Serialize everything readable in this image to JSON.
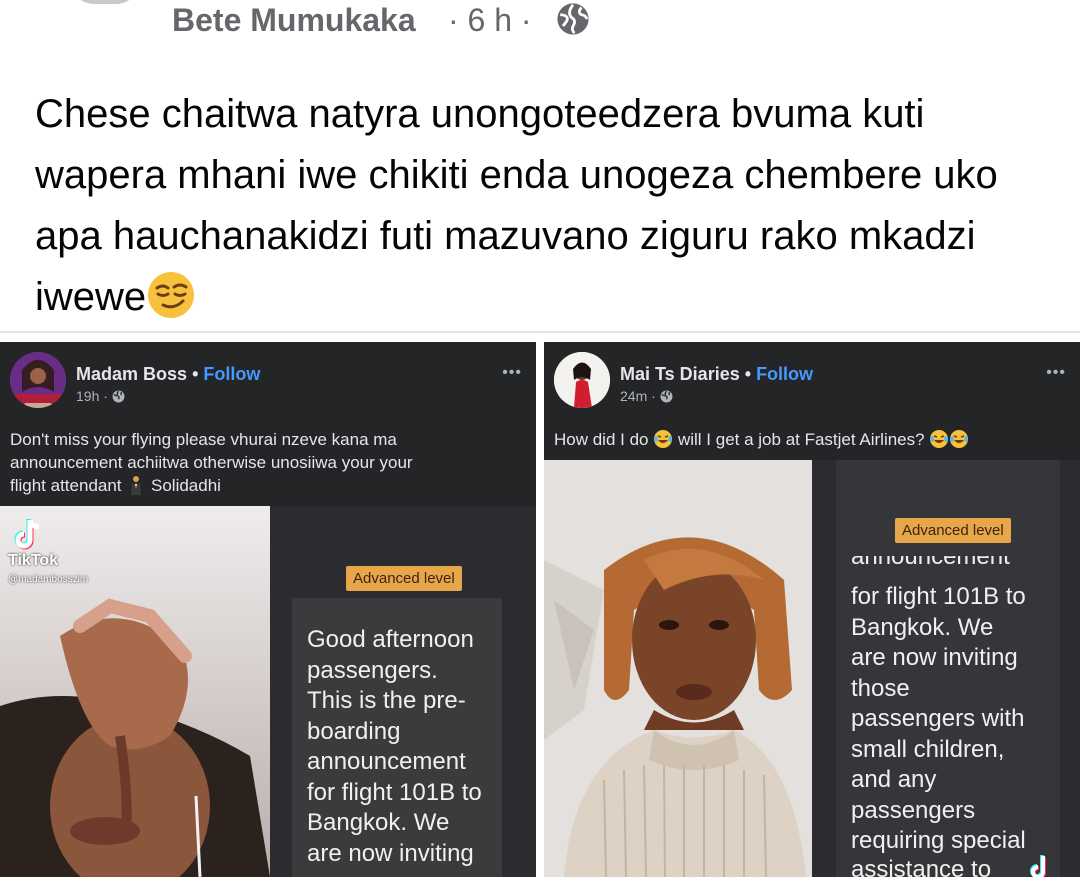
{
  "post": {
    "author": "Bete Mumukaka",
    "meta": "· 6 h ·",
    "text": "Chese chaitwa natyra unongoteedzera bvuma kuti wapera mhani iwe chikiti enda unogeza chembere uko apa hauchanakidzi futi mazuvano ziguru rako mkadzi iwewe",
    "emoji": "smirking-face"
  },
  "cards": [
    {
      "page": "Madam Boss",
      "dot": "•",
      "follow": "Follow",
      "time": "19h ·",
      "more": "•••",
      "caption_line1": "Don't miss your flying please vhurai nzeve kana ma",
      "caption_line2": "announcement achiitwa otherwise unosiiwa your your",
      "caption_line3": "flight attendant",
      "caption_name": "Solidadhi",
      "badge": "Advanced level",
      "subtitle_lines": [
        "Good afternoon",
        "passengers.",
        "This is the pre-",
        "boarding",
        "announcement",
        "for flight 101B to",
        "Bangkok. We",
        "are now inviting"
      ],
      "tiktok_word": "TikTok",
      "tiktok_handle": "@madambosszim"
    },
    {
      "page": "Mai Ts Diaries",
      "dot": "•",
      "follow": "Follow",
      "time": "24m ·",
      "more": "•••",
      "caption": "How did I do",
      "caption_mid": "will I get a job at Fastjet Airlines?",
      "badge": "Advanced level",
      "subtitle_cut_top": "announcement",
      "subtitle_lines": [
        "for flight 101B to",
        "Bangkok. We",
        "are now inviting",
        "those",
        "passengers with",
        "small children,",
        "and any",
        "passengers",
        "requiring special"
      ],
      "subtitle_cut_bottom": "assistance to"
    }
  ],
  "colors": {
    "follow": "#4599ff",
    "badge": "#e8a64a",
    "card_bg": "#242526",
    "meta_gray": "#65676b"
  }
}
